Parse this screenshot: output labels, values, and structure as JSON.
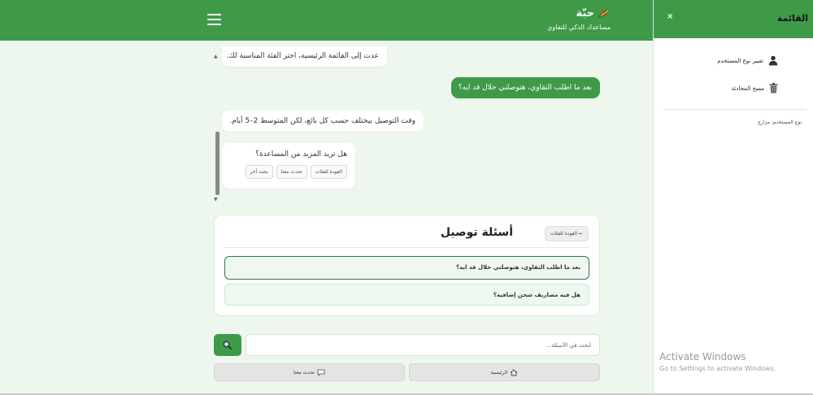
{
  "header": {
    "brand_title": "حبّة",
    "brand_subtitle": "مساعدك الذكي للتقاوي",
    "menu_icon": "hamburger-icon"
  },
  "chat": {
    "messages": [
      {
        "from": "bot",
        "text": "عدت إلى القائمة الرئيسية، اختر الفئة المناسبة لك."
      },
      {
        "from": "user",
        "text": "بعد ما اطلب التقاوي، هتوصلني خلال قد ايه؟"
      },
      {
        "from": "bot",
        "text": "وقت التوصيل بيختلف حسب كل بائع، لكن المتوسط 2–5 أيام."
      }
    ],
    "help": {
      "question": "هل تريد المزيد من المساعدة؟",
      "chips": [
        "العودة للفئات",
        "تحدث معنا",
        "بحث آخر"
      ]
    }
  },
  "questions_card": {
    "title": "أسئلة توصيل",
    "back_label": "العودة للفئات ←",
    "items": [
      "بعد ما اطلب التقاوي، هتوصلني خلال قد ايه؟",
      "هل فيه مصاريف شحن إضافية؟"
    ]
  },
  "search": {
    "placeholder": "ابحث في الأسئلة...",
    "button_icon": "magnifier-icon"
  },
  "bottom_nav": {
    "home_label": "الرئيسية",
    "chat_label": "تحدث معنا"
  },
  "sidebar": {
    "title": "القائمة",
    "close": "×",
    "items": [
      {
        "label": "تغيير نوع المستخدم",
        "icon": "user-icon"
      },
      {
        "label": "مسح المحادثة",
        "icon": "trash-icon"
      }
    ],
    "user_type_label": "نوع المستخدم: مزارع"
  },
  "os_watermark": {
    "line1": "Activate Windows",
    "line2": "Go to Settings to activate Windows."
  },
  "colors": {
    "primary": "#3f9a48",
    "main_bg": "#eef7ee",
    "item_bg": "#eef8ef",
    "active_border": "#2f6f6a"
  }
}
